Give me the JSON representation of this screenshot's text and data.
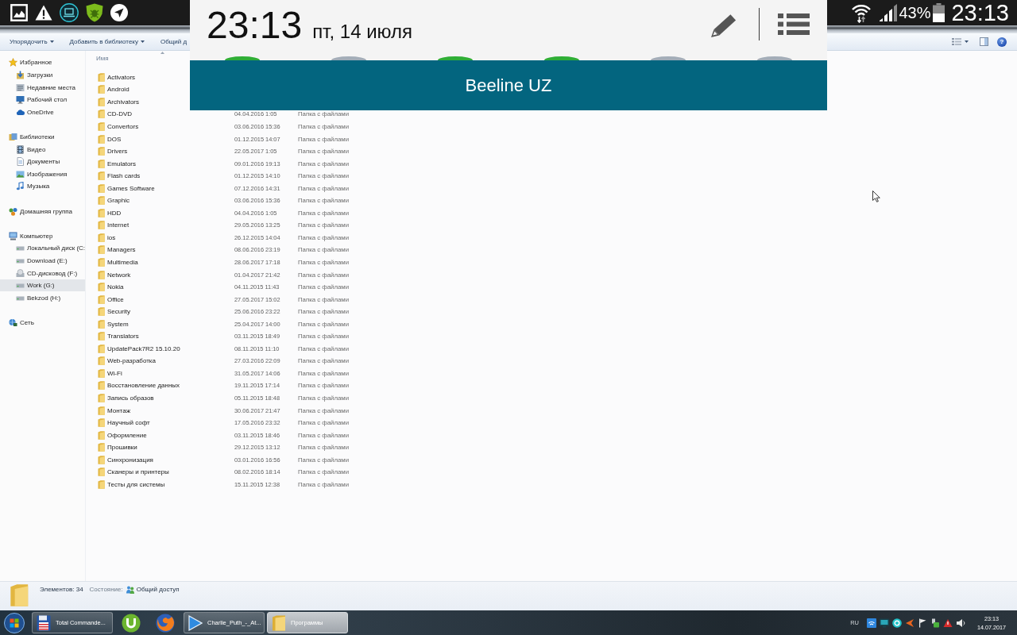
{
  "android_status_bar": {
    "battery": "43%",
    "time": "23:13"
  },
  "notification_panel": {
    "time": "23:13",
    "date": "пт, 14 июля",
    "quick_toggles": [
      {
        "on": true
      },
      {
        "on": false
      },
      {
        "on": true
      },
      {
        "on": true
      },
      {
        "on": false
      },
      {
        "on": false
      }
    ],
    "carrier": "Beeline UZ"
  },
  "explorer": {
    "toolbar": [
      {
        "label": "Упорядочить",
        "dropdown": true
      },
      {
        "label": "Добавить в библиотеку",
        "dropdown": true
      },
      {
        "label": "Общий д",
        "dropdown": false
      }
    ],
    "help_button": "?",
    "sidebar": [
      {
        "label": "Избранное",
        "selected": false,
        "children": [
          {
            "label": "Загрузки",
            "selected": false
          },
          {
            "label": "Недавние места",
            "selected": false
          },
          {
            "label": "Рабочий стол",
            "selected": false
          },
          {
            "label": "OneDrive",
            "selected": false
          }
        ]
      },
      {
        "label": "Библиотеки",
        "selected": false,
        "children": [
          {
            "label": "Видео",
            "selected": false
          },
          {
            "label": "Документы",
            "selected": false
          },
          {
            "label": "Изображения",
            "selected": false
          },
          {
            "label": "Музыка",
            "selected": false
          }
        ]
      },
      {
        "label": "Домашняя группа",
        "selected": false
      },
      {
        "label": "Компьютер",
        "selected": false,
        "children": [
          {
            "label": "Локальный диск (C:",
            "selected": false
          },
          {
            "label": "Download (E:)",
            "selected": false
          },
          {
            "label": "CD-дисковод (F:)",
            "selected": false
          },
          {
            "label": "Work (G:)",
            "selected": true
          },
          {
            "label": "Bekzod (H:)",
            "selected": false
          }
        ]
      },
      {
        "label": "Сеть",
        "selected": false
      }
    ],
    "columns": [
      "Имя"
    ],
    "rows": [
      {
        "name": "Activators"
      },
      {
        "name": "Android"
      },
      {
        "name": "Archivators"
      },
      {
        "name": "CD-DVD",
        "column_2": "04.04.2016 1:05",
        "column_3": "Папка с файлами"
      },
      {
        "name": "Convertors",
        "column_2": "03.06.2016 15:36",
        "column_3": "Папка с файлами"
      },
      {
        "name": "DOS",
        "column_2": "01.12.2015 14:07",
        "column_3": "Папка с файлами"
      },
      {
        "name": "Drivers",
        "column_2": "22.05.2017 1:05",
        "column_3": "Папка с файлами"
      },
      {
        "name": "Emulators",
        "column_2": "09.01.2016 19:13",
        "column_3": "Папка с файлами"
      },
      {
        "name": "Flash cards",
        "column_2": "01.12.2015 14:10",
        "column_3": "Папка с файлами"
      },
      {
        "name": "Games Software",
        "column_2": "07.12.2016 14:31",
        "column_3": "Папка с файлами"
      },
      {
        "name": "Graphic",
        "column_2": "03.06.2016 15:36",
        "column_3": "Папка с файлами"
      },
      {
        "name": "HDD",
        "column_2": "04.04.2016 1:05",
        "column_3": "Папка с файлами"
      },
      {
        "name": "Internet",
        "column_2": "29.05.2016 13:25",
        "column_3": "Папка с файлами"
      },
      {
        "name": "ios",
        "column_2": "26.12.2015 14:04",
        "column_3": "Папка с файлами"
      },
      {
        "name": "Managers",
        "column_2": "08.06.2016 23:19",
        "column_3": "Папка с файлами"
      },
      {
        "name": "Multimedia",
        "column_2": "28.06.2017 17:18",
        "column_3": "Папка с файлами"
      },
      {
        "name": "Network",
        "column_2": "01.04.2017 21:42",
        "column_3": "Папка с файлами"
      },
      {
        "name": "Nokia",
        "column_2": "04.11.2015 11:43",
        "column_3": "Папка с файлами"
      },
      {
        "name": "Office",
        "column_2": "27.05.2017 15:02",
        "column_3": "Папка с файлами"
      },
      {
        "name": "Security",
        "column_2": "25.06.2016 23:22",
        "column_3": "Папка с файлами"
      },
      {
        "name": "System",
        "column_2": "25.04.2017 14:00",
        "column_3": "Папка с файлами"
      },
      {
        "name": "Translators",
        "column_2": "03.11.2015 18:49",
        "column_3": "Папка с файлами"
      },
      {
        "name": "UpdatePack7R2 15.10.20",
        "column_2": "08.11.2015 11:10",
        "column_3": "Папка с файлами"
      },
      {
        "name": "Web-разработка",
        "column_2": "27.03.2016 22:09",
        "column_3": "Папка с файлами"
      },
      {
        "name": "Wi-Fi",
        "column_2": "31.05.2017 14:06",
        "column_3": "Папка с файлами"
      },
      {
        "name": "Восстановление данных",
        "column_2": "19.11.2015 17:14",
        "column_3": "Папка с файлами"
      },
      {
        "name": "Запись образов",
        "column_2": "05.11.2015 18:48",
        "column_3": "Папка с файлами"
      },
      {
        "name": "Монтаж",
        "column_2": "30.06.2017 21:47",
        "column_3": "Папка с файлами"
      },
      {
        "name": "Научный софт",
        "column_2": "17.05.2016 23:32",
        "column_3": "Папка с файлами"
      },
      {
        "name": "Оформление",
        "column_2": "03.11.2015 18:46",
        "column_3": "Папка с файлами"
      },
      {
        "name": "Прошивки",
        "column_2": "29.12.2015 13:12",
        "column_3": "Папка с файлами"
      },
      {
        "name": "Синхронизация",
        "column_2": "03.01.2016 16:56",
        "column_3": "Папка с файлами"
      },
      {
        "name": "Сканеры и принтеры",
        "column_2": "08.02.2016 18:14",
        "column_3": "Папка с файлами"
      },
      {
        "name": "Тесты для системы",
        "column_2": "15.11.2015 12:38",
        "column_3": "Папка с файлами"
      }
    ],
    "status_bar": {
      "item_count": "Элементов: 34",
      "state_label": "Состояние:",
      "state_value": "Общий доступ"
    }
  },
  "taskbar": {
    "items": [
      {
        "kind": "window",
        "label": "Total Commande...",
        "selected": false
      },
      {
        "kind": "pinned",
        "selected": false
      },
      {
        "kind": "pinned",
        "selected": false
      },
      {
        "kind": "window",
        "label": "Charlie_Puth_-_At...",
        "selected": false
      },
      {
        "kind": "window",
        "label": "Программы",
        "selected": true
      }
    ],
    "language": "RU",
    "clock": {
      "time": "23:13",
      "date": "14.07.2017"
    }
  }
}
